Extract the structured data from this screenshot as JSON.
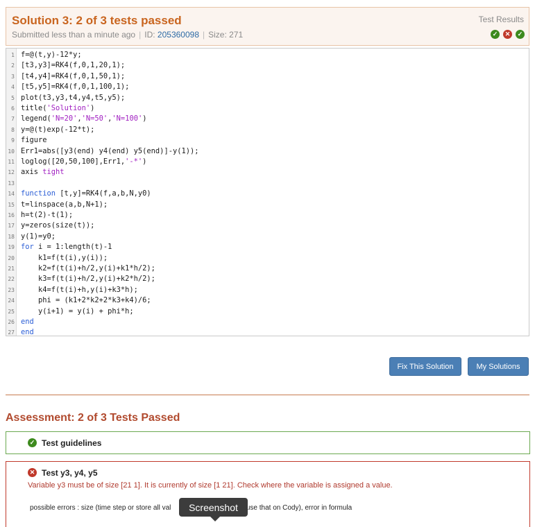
{
  "solution": {
    "title": "Solution 3: 2 of 3 tests passed",
    "submitted": "Submitted less than a minute ago",
    "id_label": "ID:",
    "id_value": "205360098",
    "size_label": "Size: 271",
    "test_results_label": "Test Results",
    "test_icons": [
      "check-icon",
      "x-icon",
      "check-icon"
    ]
  },
  "code_lines": [
    {
      "n": "1",
      "parts": [
        {
          "t": "f=@(t,y)-12*y;"
        }
      ]
    },
    {
      "n": "2",
      "parts": [
        {
          "t": "[t3,y3]=RK4(f,0,1,20,1);"
        }
      ]
    },
    {
      "n": "3",
      "parts": [
        {
          "t": "[t4,y4]=RK4(f,0,1,50,1);"
        }
      ]
    },
    {
      "n": "4",
      "parts": [
        {
          "t": "[t5,y5]=RK4(f,0,1,100,1);"
        }
      ]
    },
    {
      "n": "5",
      "parts": [
        {
          "t": "plot(t3,y3,t4,y4,t5,y5);"
        }
      ]
    },
    {
      "n": "6",
      "parts": [
        {
          "t": "title("
        },
        {
          "t": "'Solution'",
          "c": "str"
        },
        {
          "t": ")"
        }
      ]
    },
    {
      "n": "7",
      "parts": [
        {
          "t": "legend("
        },
        {
          "t": "'N=20'",
          "c": "str"
        },
        {
          "t": ","
        },
        {
          "t": "'N=50'",
          "c": "str"
        },
        {
          "t": ","
        },
        {
          "t": "'N=100'",
          "c": "str"
        },
        {
          "t": ")"
        }
      ]
    },
    {
      "n": "8",
      "parts": [
        {
          "t": "y=@(t)exp(-12*t);"
        }
      ]
    },
    {
      "n": "9",
      "parts": [
        {
          "t": "figure"
        }
      ]
    },
    {
      "n": "10",
      "parts": [
        {
          "t": "Err1=abs([y3(end) y4(end) y5(end)]-y(1));"
        }
      ]
    },
    {
      "n": "11",
      "parts": [
        {
          "t": "loglog([20,50,100],Err1,"
        },
        {
          "t": "'-*'",
          "c": "str"
        },
        {
          "t": ")"
        }
      ]
    },
    {
      "n": "12",
      "parts": [
        {
          "t": "axis "
        },
        {
          "t": "tight",
          "c": "str"
        }
      ]
    },
    {
      "n": "13",
      "parts": [
        {
          "t": ""
        }
      ]
    },
    {
      "n": "14",
      "parts": [
        {
          "t": "function",
          "c": "kw"
        },
        {
          "t": " [t,y]=RK4(f,a,b,N,y0)"
        }
      ]
    },
    {
      "n": "15",
      "parts": [
        {
          "t": "t=linspace(a,b,N+1);"
        }
      ]
    },
    {
      "n": "16",
      "parts": [
        {
          "t": "h=t(2)-t(1);"
        }
      ]
    },
    {
      "n": "17",
      "parts": [
        {
          "t": "y=zeros(size(t));"
        }
      ]
    },
    {
      "n": "18",
      "parts": [
        {
          "t": "y(1)=y0;"
        }
      ]
    },
    {
      "n": "19",
      "parts": [
        {
          "t": "for",
          "c": "kw"
        },
        {
          "t": " i = 1:length(t)-1"
        }
      ]
    },
    {
      "n": "20",
      "parts": [
        {
          "t": "    k1=f(t(i),y(i));"
        }
      ]
    },
    {
      "n": "21",
      "parts": [
        {
          "t": "    k2=f(t(i)+h/2,y(i)+k1*h/2);"
        }
      ]
    },
    {
      "n": "22",
      "parts": [
        {
          "t": "    k3=f(t(i)+h/2,y(i)+k2*h/2);"
        }
      ]
    },
    {
      "n": "23",
      "parts": [
        {
          "t": "    k4=f(t(i)+h,y(i)+k3*h);"
        }
      ]
    },
    {
      "n": "24",
      "parts": [
        {
          "t": "    phi = (k1+2*k2+2*k3+k4)/6;"
        }
      ]
    },
    {
      "n": "25",
      "parts": [
        {
          "t": "    y(i+1) = y(i) + phi*h;"
        }
      ]
    },
    {
      "n": "26",
      "parts": [
        {
          "t": "end",
          "c": "kw"
        }
      ]
    },
    {
      "n": "27",
      "parts": [
        {
          "t": "end",
          "c": "kw"
        }
      ]
    }
  ],
  "buttons": {
    "fix": "Fix This Solution",
    "my_solutions": "My Solutions"
  },
  "assessment": {
    "title": "Assessment: 2 of 3 Tests Passed",
    "tests": [
      {
        "name": "Test guidelines",
        "status": "pass"
      },
      {
        "name": "Test y3, y4, y5",
        "status": "fail",
        "message": "Variable y3 must be of size [21 1]. It is currently of size [1 21]. Check where the variable is assigned a value.",
        "possible_errors": "possible errors : size (time step or store all val",
        "possible_errors_tail": "'t use that on Cody), error in formula"
      }
    ]
  },
  "tooltip": "Screenshot",
  "colors": {
    "accent": "#c9651f",
    "pass": "#3d8a1e",
    "fail": "#c0392b",
    "button": "#4b7fb5"
  }
}
